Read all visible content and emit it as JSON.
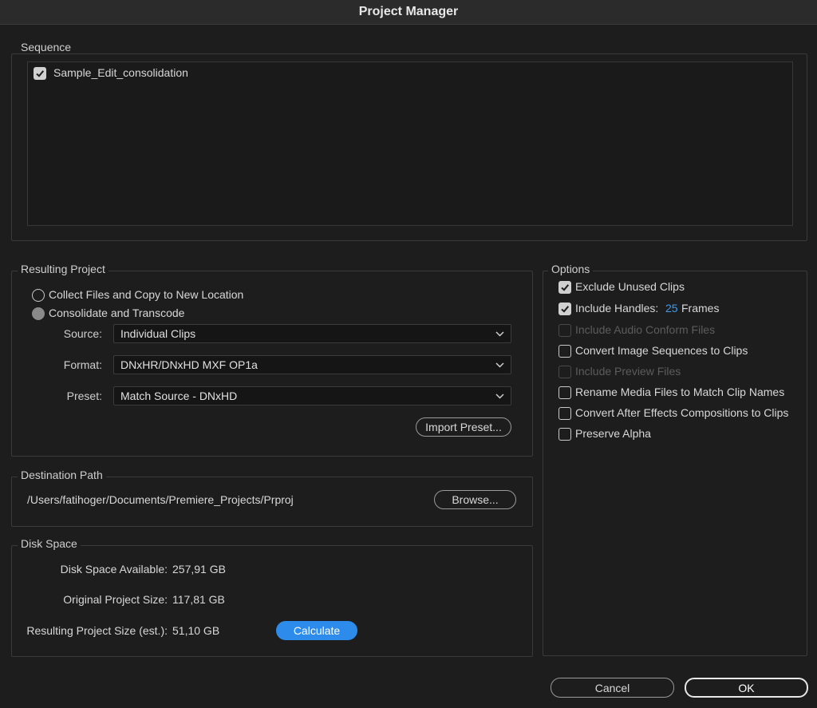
{
  "window": {
    "title": "Project Manager"
  },
  "sequence": {
    "legend": "Sequence",
    "items": [
      {
        "label": "Sample_Edit_consolidation",
        "checked": true
      }
    ]
  },
  "resulting_project": {
    "legend": "Resulting Project",
    "option_collect": "Collect Files and Copy to New Location",
    "option_consolidate": "Consolidate and Transcode",
    "source_label": "Source:",
    "source_value": "Individual Clips",
    "format_label": "Format:",
    "format_value": "DNxHR/DNxHD MXF OP1a",
    "preset_label": "Preset:",
    "preset_value": "Match Source - DNxHD",
    "import_preset_button": "Import Preset..."
  },
  "destination": {
    "legend": "Destination Path",
    "path": "/Users/fatihoger/Documents/Premiere_Projects/Prproj",
    "browse_button": "Browse..."
  },
  "disk_space": {
    "legend": "Disk Space",
    "available_label": "Disk Space Available:",
    "available_value": "257,91 GB",
    "original_label": "Original Project Size:",
    "original_value": "117,81 GB",
    "resulting_label": "Resulting Project Size (est.):",
    "resulting_value": "51,10 GB",
    "calculate_button": "Calculate"
  },
  "options": {
    "legend": "Options",
    "exclude_unused": "Exclude Unused Clips",
    "include_handles": "Include Handles:",
    "handles_value": "25",
    "handles_unit": "Frames",
    "include_audio_conform": "Include Audio Conform Files",
    "convert_image_sequences": "Convert Image Sequences to Clips",
    "include_preview": "Include Preview Files",
    "rename_media": "Rename Media Files to Match Clip Names",
    "convert_ae": "Convert After Effects Compositions to Clips",
    "preserve_alpha": "Preserve Alpha"
  },
  "footer": {
    "cancel_button": "Cancel",
    "ok_button": "OK"
  },
  "colors": {
    "accent": "#2d8ceb",
    "link_blue": "#3d9cf0",
    "background": "#1d1d1d"
  }
}
